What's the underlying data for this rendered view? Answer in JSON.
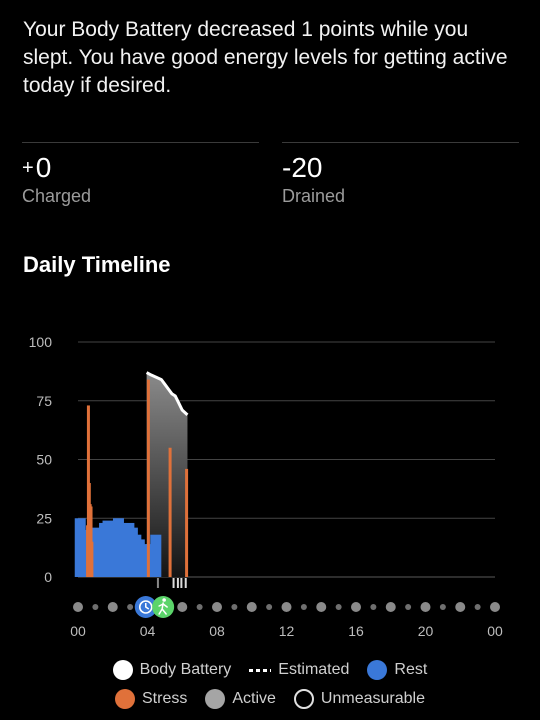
{
  "summary": {
    "text": "Your Body Battery decreased 1 points while you slept. You have good energy levels for getting active today if desired."
  },
  "stats": {
    "charged": {
      "prefix": "+",
      "value": "0",
      "label": "Charged"
    },
    "drained": {
      "value": "-20",
      "label": "Drained"
    }
  },
  "timeline": {
    "title": "Daily Timeline"
  },
  "chart_data": {
    "type": "bar",
    "title": "",
    "xlabel": "",
    "ylabel": "",
    "ylim": [
      0,
      100
    ],
    "xlim_hours": [
      0,
      24
    ],
    "y_ticks": [
      "100",
      "75",
      "50",
      "25",
      "0"
    ],
    "y_tick_values": [
      100,
      75,
      50,
      25,
      0
    ],
    "x_ticks": [
      "00",
      "04",
      "08",
      "12",
      "16",
      "20",
      "00"
    ],
    "x_tick_hours": [
      0,
      4,
      8,
      12,
      16,
      20,
      24
    ],
    "grid": true,
    "series": [
      {
        "name": "Body Battery",
        "color": "#ffffff",
        "x_hours": [
          3.95,
          4.2,
          4.5,
          4.8,
          5.0,
          5.2,
          5.4,
          5.6,
          5.8,
          6.0,
          6.15,
          6.3
        ],
        "y": [
          87,
          86,
          85,
          84,
          82,
          80,
          78,
          77,
          74,
          71,
          70,
          69
        ]
      },
      {
        "name": "Stress",
        "color": "#e0713a",
        "x_hours": [
          0.55,
          0.6,
          0.65,
          0.7,
          0.75,
          0.8,
          4.05,
          5.3,
          6.25
        ],
        "y": [
          22,
          73,
          40,
          31,
          30,
          15,
          84,
          55,
          46
        ]
      },
      {
        "name": "Rest",
        "color": "#3a78d8",
        "x_range_hours": [
          0.0,
          4.6
        ],
        "x_hours": [
          0.1,
          0.3,
          0.5,
          0.9,
          1.1,
          1.3,
          1.5,
          1.7,
          1.9,
          2.1,
          2.3,
          2.5,
          2.7,
          2.9,
          3.1,
          3.3,
          3.5,
          3.7,
          3.9,
          4.2,
          4.45
        ],
        "y": [
          25,
          20,
          18,
          21,
          15,
          19,
          23,
          24,
          16,
          22,
          25,
          18,
          20,
          23,
          21,
          18,
          16,
          14,
          10,
          14,
          18
        ]
      },
      {
        "name": "Active",
        "color": "#a5a5a5",
        "x_range_hours": [
          3.95,
          6.3
        ]
      }
    ],
    "timeline_markers": [
      {
        "icon": "rest-clock-icon",
        "hour": 3.9,
        "color": "#3a78d8"
      },
      {
        "icon": "walking-activity-icon",
        "hour": 4.9,
        "color": "#5bd46a"
      }
    ]
  },
  "legend": {
    "items": [
      {
        "label": "Body Battery"
      },
      {
        "label": "Estimated"
      },
      {
        "label": "Rest"
      },
      {
        "label": "Stress"
      },
      {
        "label": "Active"
      },
      {
        "label": "Unmeasurable"
      }
    ]
  }
}
